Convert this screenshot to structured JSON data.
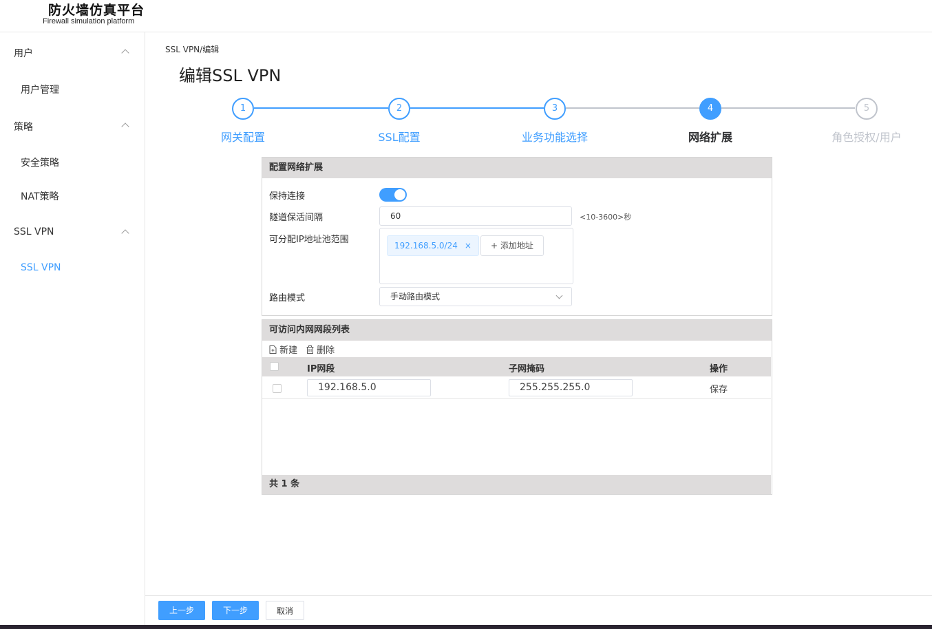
{
  "header": {
    "title": "防火墙仿真平台",
    "subtitle": "Firewall simulation platform"
  },
  "sidebar": {
    "groups": [
      {
        "label": "用户",
        "items": [
          {
            "label": "用户管理"
          }
        ]
      },
      {
        "label": "策略",
        "items": [
          {
            "label": "安全策略"
          },
          {
            "label": "NAT策略"
          }
        ]
      },
      {
        "label": "SSL VPN",
        "items": [
          {
            "label": "SSL VPN"
          }
        ]
      }
    ]
  },
  "breadcrumb": "SSL VPN/编辑",
  "page_title": "编辑SSL VPN",
  "steps": [
    {
      "number": "1",
      "label": "网关配置",
      "status": "done"
    },
    {
      "number": "2",
      "label": "SSL配置",
      "status": "done"
    },
    {
      "number": "3",
      "label": "业务功能选择",
      "status": "done"
    },
    {
      "number": "4",
      "label": "网络扩展",
      "status": "active"
    },
    {
      "number": "5",
      "label": "角色授权/用户",
      "status": "todo"
    }
  ],
  "network_extension": {
    "title": "配置网络扩展",
    "keep_alive_label": "保持连接",
    "keep_alive_on": true,
    "tunnel_interval_label": "隧道保活间隔",
    "tunnel_interval_value": "60",
    "tunnel_interval_hint": "<10-3600>秒",
    "ip_pool_label": "可分配IP地址池范围",
    "ip_pool_tags": [
      "192.168.5.0/24"
    ],
    "tag_close": "×",
    "add_address_label": "+ 添加地址",
    "route_mode_label": "路由模式",
    "route_mode_value": "手动路由模式"
  },
  "intranet_table": {
    "title": "可访问内网网段列表",
    "new_label": "新建",
    "delete_label": "删除",
    "columns": [
      "IP网段",
      "子网掩码",
      "操作"
    ],
    "rows": [
      {
        "ip": "192.168.5.0",
        "mask": "255.255.255.0",
        "action": "保存"
      }
    ],
    "footer": "共 1 条"
  },
  "bottom_buttons": {
    "prev": "上一步",
    "next": "下一步",
    "cancel": "取消"
  },
  "colors": {
    "accent": "#409eff",
    "panel_header": "#dedcdc",
    "inactive_step": "#c0c4cc"
  }
}
